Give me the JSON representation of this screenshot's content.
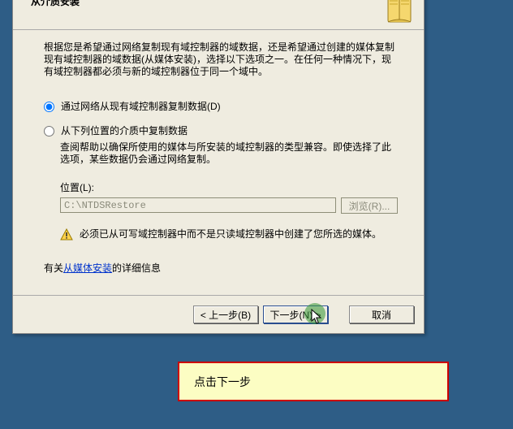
{
  "header": {
    "title": "从介质安装"
  },
  "intro": "根据您是希望通过网络复制现有域控制器的域数据，还是希望通过创建的媒体复制现有域控制器的域数据(从媒体安装)，选择以下选项之一。在任何一种情况下，现有域控制器都必须与新的域控制器位于同一个域中。",
  "options": {
    "opt1": "通过网络从现有域控制器复制数据(D)",
    "opt2": "从下列位置的介质中复制数据",
    "opt2_note": "查阅帮助以确保所使用的媒体与所安装的域控制器的类型兼容。即使选择了此选项，某些数据仍会通过网络复制。"
  },
  "path": {
    "label": "位置(L):",
    "value": "C:\\NTDSRestore",
    "browse": "浏览(R)..."
  },
  "warning": "必须已从可写域控制器中而不是只读域控制器中创建了您所选的媒体。",
  "link_row": {
    "prefix": "有关",
    "link": "从媒体安装",
    "suffix": "的详细信息"
  },
  "buttons": {
    "back": "< 上一步(B)",
    "next": "下一步(N) >",
    "cancel": "取消"
  },
  "callout": "点击下一步"
}
